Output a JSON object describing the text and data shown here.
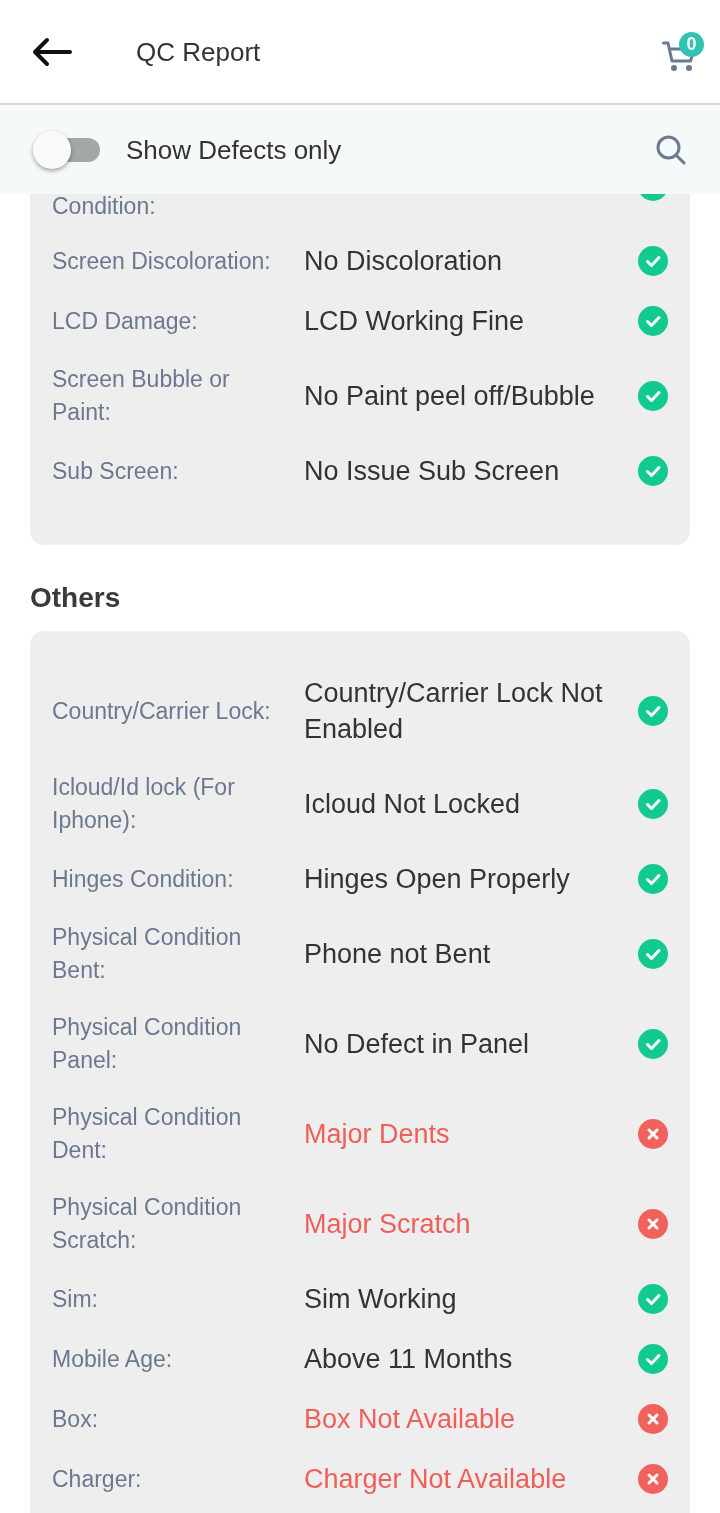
{
  "header": {
    "title": "QC Report",
    "cart_count": "0"
  },
  "filter_bar": {
    "label": "Show Defects only",
    "on": false
  },
  "sections": [
    {
      "rows": [
        {
          "label": "Condition:",
          "defect": false
        },
        {
          "label": "Screen Discoloration:",
          "value": "No Discoloration",
          "defect": false
        },
        {
          "label": "LCD Damage:",
          "value": "LCD Working Fine",
          "defect": false
        },
        {
          "label": "Screen Bubble or Paint:",
          "value": "No Paint peel off/Bubble",
          "defect": false
        },
        {
          "label": "Sub Screen:",
          "value": "No Issue Sub Screen",
          "defect": false
        }
      ]
    },
    {
      "title": "Others",
      "rows": [
        {
          "label": "Country/Carrier Lock:",
          "value": "Country/Carrier Lock Not Enabled",
          "defect": false
        },
        {
          "label": "Icloud/Id lock (For Iphone):",
          "value": "Icloud Not Locked",
          "defect": false
        },
        {
          "label": "Hinges Condition:",
          "value": "Hinges Open Properly",
          "defect": false
        },
        {
          "label": "Physical Condition Bent:",
          "value": "Phone not Bent",
          "defect": false
        },
        {
          "label": "Physical Condition Panel:",
          "value": "No Defect in Panel",
          "defect": false
        },
        {
          "label": "Physical Condition Dent:",
          "value": "Major Dents",
          "defect": true
        },
        {
          "label": "Physical Condition Scratch:",
          "value": "Major Scratch",
          "defect": true
        },
        {
          "label": "Sim:",
          "value": "Sim Working",
          "defect": false
        },
        {
          "label": "Mobile Age:",
          "value": "Above 11 Months",
          "defect": false
        },
        {
          "label": "Box:",
          "value": "Box Not Available",
          "defect": true
        },
        {
          "label": "Charger:",
          "value": "Charger Not Available",
          "defect": true
        }
      ]
    }
  ]
}
